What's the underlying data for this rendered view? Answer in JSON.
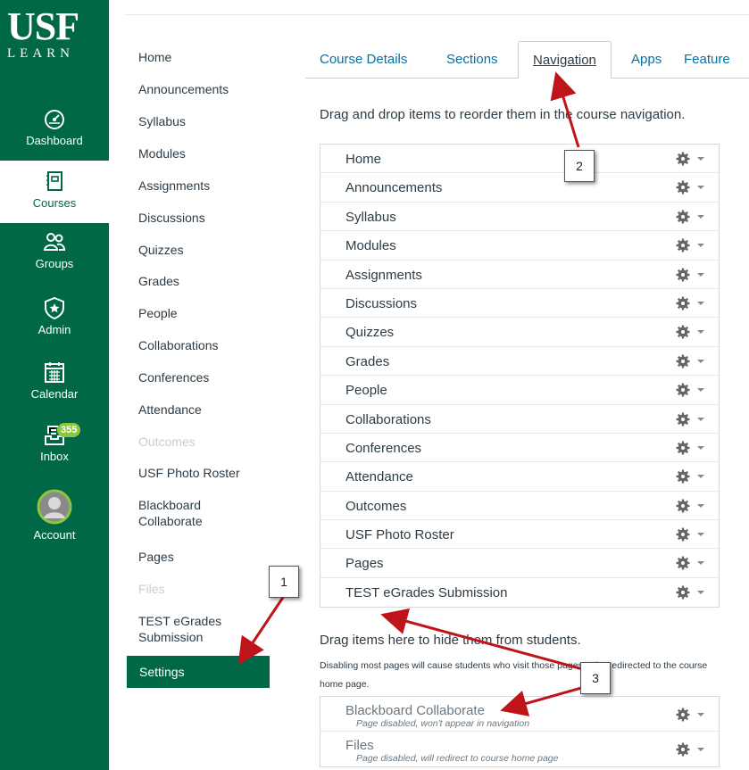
{
  "brand": {
    "logo_main": "USF",
    "logo_sub": "LEARN",
    "nav_color": "#006747",
    "accent": "#8cc63f"
  },
  "global_nav": [
    {
      "label": "Dashboard",
      "icon": "dashboard-icon"
    },
    {
      "label": "Courses",
      "icon": "courses-icon",
      "active": true
    },
    {
      "label": "Groups",
      "icon": "groups-icon"
    },
    {
      "label": "Admin",
      "icon": "admin-icon"
    },
    {
      "label": "Calendar",
      "icon": "calendar-icon"
    },
    {
      "label": "Inbox",
      "icon": "inbox-icon",
      "badge": "355"
    },
    {
      "label": "Account",
      "icon": "account-avatar"
    }
  ],
  "course_nav": [
    {
      "label": "Home"
    },
    {
      "label": "Announcements"
    },
    {
      "label": "Syllabus"
    },
    {
      "label": "Modules"
    },
    {
      "label": "Assignments"
    },
    {
      "label": "Discussions"
    },
    {
      "label": "Quizzes"
    },
    {
      "label": "Grades"
    },
    {
      "label": "People"
    },
    {
      "label": "Collaborations"
    },
    {
      "label": "Conferences"
    },
    {
      "label": "Attendance"
    },
    {
      "label": "Outcomes",
      "disabled": true
    },
    {
      "label": "USF Photo Roster"
    },
    {
      "label": "Blackboard Collaborate"
    },
    {
      "label": "Pages"
    },
    {
      "label": "Files",
      "disabled": true
    },
    {
      "label": "TEST eGrades Submission"
    }
  ],
  "settings_label": "Settings",
  "tabs": [
    {
      "label": "Course Details"
    },
    {
      "label": "Sections"
    },
    {
      "label": "Navigation",
      "active": true
    },
    {
      "label": "Apps"
    },
    {
      "label": "Feature"
    }
  ],
  "instruction": "Drag and drop items to reorder them in the course navigation.",
  "nav_items": [
    "Home",
    "Announcements",
    "Syllabus",
    "Modules",
    "Assignments",
    "Discussions",
    "Quizzes",
    "Grades",
    "People",
    "Collaborations",
    "Conferences",
    "Attendance",
    "Outcomes",
    "USF Photo Roster",
    "Pages",
    "TEST eGrades Submission"
  ],
  "hide_title": "Drag items here to hide them from students.",
  "hide_note": "Disabling most pages will cause students who visit those pages to be redirected to the course home page.",
  "hidden_items": [
    {
      "name": "Blackboard Collaborate",
      "note": "Page disabled, won't appear in navigation"
    },
    {
      "name": "Files",
      "note": "Page disabled, will redirect to course home page"
    }
  ],
  "callouts": {
    "c1": "1",
    "c2": "2",
    "c3": "3",
    "arrow_color": "#c0141b"
  }
}
